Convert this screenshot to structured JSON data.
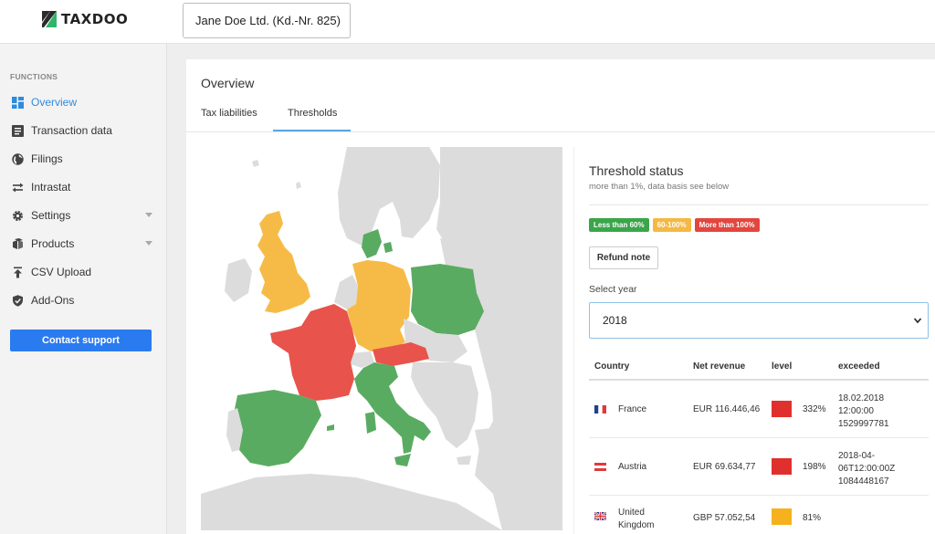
{
  "app": {
    "logo_text": "TAXDOO",
    "client_select": {
      "value": "Jane Doe Ltd. (Kd.-Nr. 825)"
    }
  },
  "sidebar": {
    "header": "FUNCTIONS",
    "items": [
      {
        "label": "Overview",
        "icon": "dashboard-icon",
        "active": true
      },
      {
        "label": "Transaction data",
        "icon": "list-icon"
      },
      {
        "label": "Filings",
        "icon": "globe-icon"
      },
      {
        "label": "Intrastat",
        "icon": "swap-arrows-icon"
      },
      {
        "label": "Settings",
        "icon": "gear-icon",
        "expandable": true
      },
      {
        "label": "Products",
        "icon": "products-icon",
        "expandable": true
      },
      {
        "label": "CSV Upload",
        "icon": "upload-icon"
      },
      {
        "label": "Add-Ons",
        "icon": "shield-check-icon"
      }
    ],
    "contact_support_label": "Contact support"
  },
  "main": {
    "title": "Overview",
    "tabs": [
      {
        "label": "Tax liabilities",
        "active": false
      },
      {
        "label": "Thresholds",
        "active": true
      }
    ]
  },
  "threshold": {
    "title": "Threshold status",
    "subtitle": "more than 1%, data basis see below",
    "legend": [
      {
        "label": "Less than 60%",
        "color": "#3aa54a"
      },
      {
        "label": "60-100%",
        "color": "#f5b942"
      },
      {
        "label": "More than 100%",
        "color": "#e2463f"
      }
    ],
    "refund_note_label": "Refund note",
    "select_year_label": "Select year",
    "year_value": "2018",
    "table": {
      "headers": [
        "Country",
        "Net revenue",
        "level",
        "exceeded"
      ],
      "rows": [
        {
          "country": "France",
          "flag": "france-flag-icon",
          "revenue": "EUR 116.446,46",
          "level_color": "#e0302d",
          "percent": "332%",
          "exceeded_lines": [
            "18.02.2018",
            "12:00:00",
            "1529997781"
          ]
        },
        {
          "country": "Austria",
          "flag": "austria-flag-icon",
          "revenue": "EUR 69.634,77",
          "level_color": "#e0302d",
          "percent": "198%",
          "exceeded_lines": [
            "2018-04-",
            "06T12:00:00Z",
            "1084448167"
          ]
        },
        {
          "country_lines": [
            "United",
            "Kingdom"
          ],
          "flag": "uk-flag-icon",
          "revenue": "GBP 57.052,54",
          "level_color": "#f5b21e",
          "percent": "81%"
        }
      ]
    }
  },
  "map": {
    "colors": {
      "water": "#ffffff",
      "land": "#dcdcdc",
      "green": "#5aab62",
      "orange": "#f6bb47",
      "red": "#e8534b"
    },
    "countries": {
      "france": "red",
      "austria": "red",
      "corsica": "red",
      "united-kingdom": "orange",
      "germany": "orange",
      "spain": "green",
      "italy": "green",
      "poland": "green",
      "denmark": "green",
      "sardinia": "green"
    }
  }
}
